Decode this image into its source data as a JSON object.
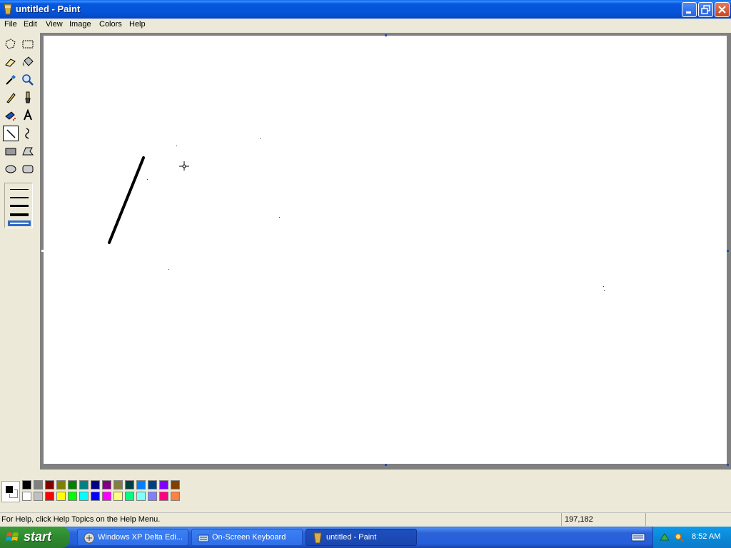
{
  "window": {
    "title": "untitled - Paint"
  },
  "menu": [
    "File",
    "Edit",
    "View",
    "Image",
    "Colors",
    "Help"
  ],
  "tools": [
    {
      "name": "free-form-select-tool-icon"
    },
    {
      "name": "select-tool-icon"
    },
    {
      "name": "eraser-tool-icon"
    },
    {
      "name": "fill-tool-icon"
    },
    {
      "name": "pick-color-tool-icon"
    },
    {
      "name": "magnifier-tool-icon"
    },
    {
      "name": "pencil-tool-icon"
    },
    {
      "name": "brush-tool-icon"
    },
    {
      "name": "airbrush-tool-icon"
    },
    {
      "name": "text-tool-icon",
      "glyph": "A"
    },
    {
      "name": "line-tool-icon",
      "selected": true
    },
    {
      "name": "curve-tool-icon"
    },
    {
      "name": "rectangle-tool-icon"
    },
    {
      "name": "polygon-tool-icon"
    },
    {
      "name": "ellipse-tool-icon"
    },
    {
      "name": "rounded-rectangle-tool-icon"
    }
  ],
  "palette": {
    "foreground": "#000000",
    "background": "#ffffff",
    "row1": [
      "#000000",
      "#808080",
      "#800000",
      "#808000",
      "#008000",
      "#008080",
      "#000080",
      "#800080",
      "#808040",
      "#004040",
      "#0080ff",
      "#004080",
      "#8000ff",
      "#804000"
    ],
    "row2": [
      "#ffffff",
      "#c0c0c0",
      "#ff0000",
      "#ffff00",
      "#00ff00",
      "#00ffff",
      "#0000ff",
      "#ff00ff",
      "#ffff80",
      "#00ff80",
      "#80ffff",
      "#8080ff",
      "#ff0080",
      "#ff8040"
    ]
  },
  "status": {
    "help": "For Help, click Help Topics on the Help Menu.",
    "coords": "197,182"
  },
  "taskbar": {
    "start": "start",
    "tasks": [
      {
        "label": "Windows XP Delta Edi...",
        "icon": "xp-logo-icon"
      },
      {
        "label": "On-Screen Keyboard",
        "icon": "keyboard-icon"
      },
      {
        "label": "untitled - Paint",
        "icon": "paint-icon",
        "active": true
      }
    ],
    "clock": "8:52 AM"
  }
}
